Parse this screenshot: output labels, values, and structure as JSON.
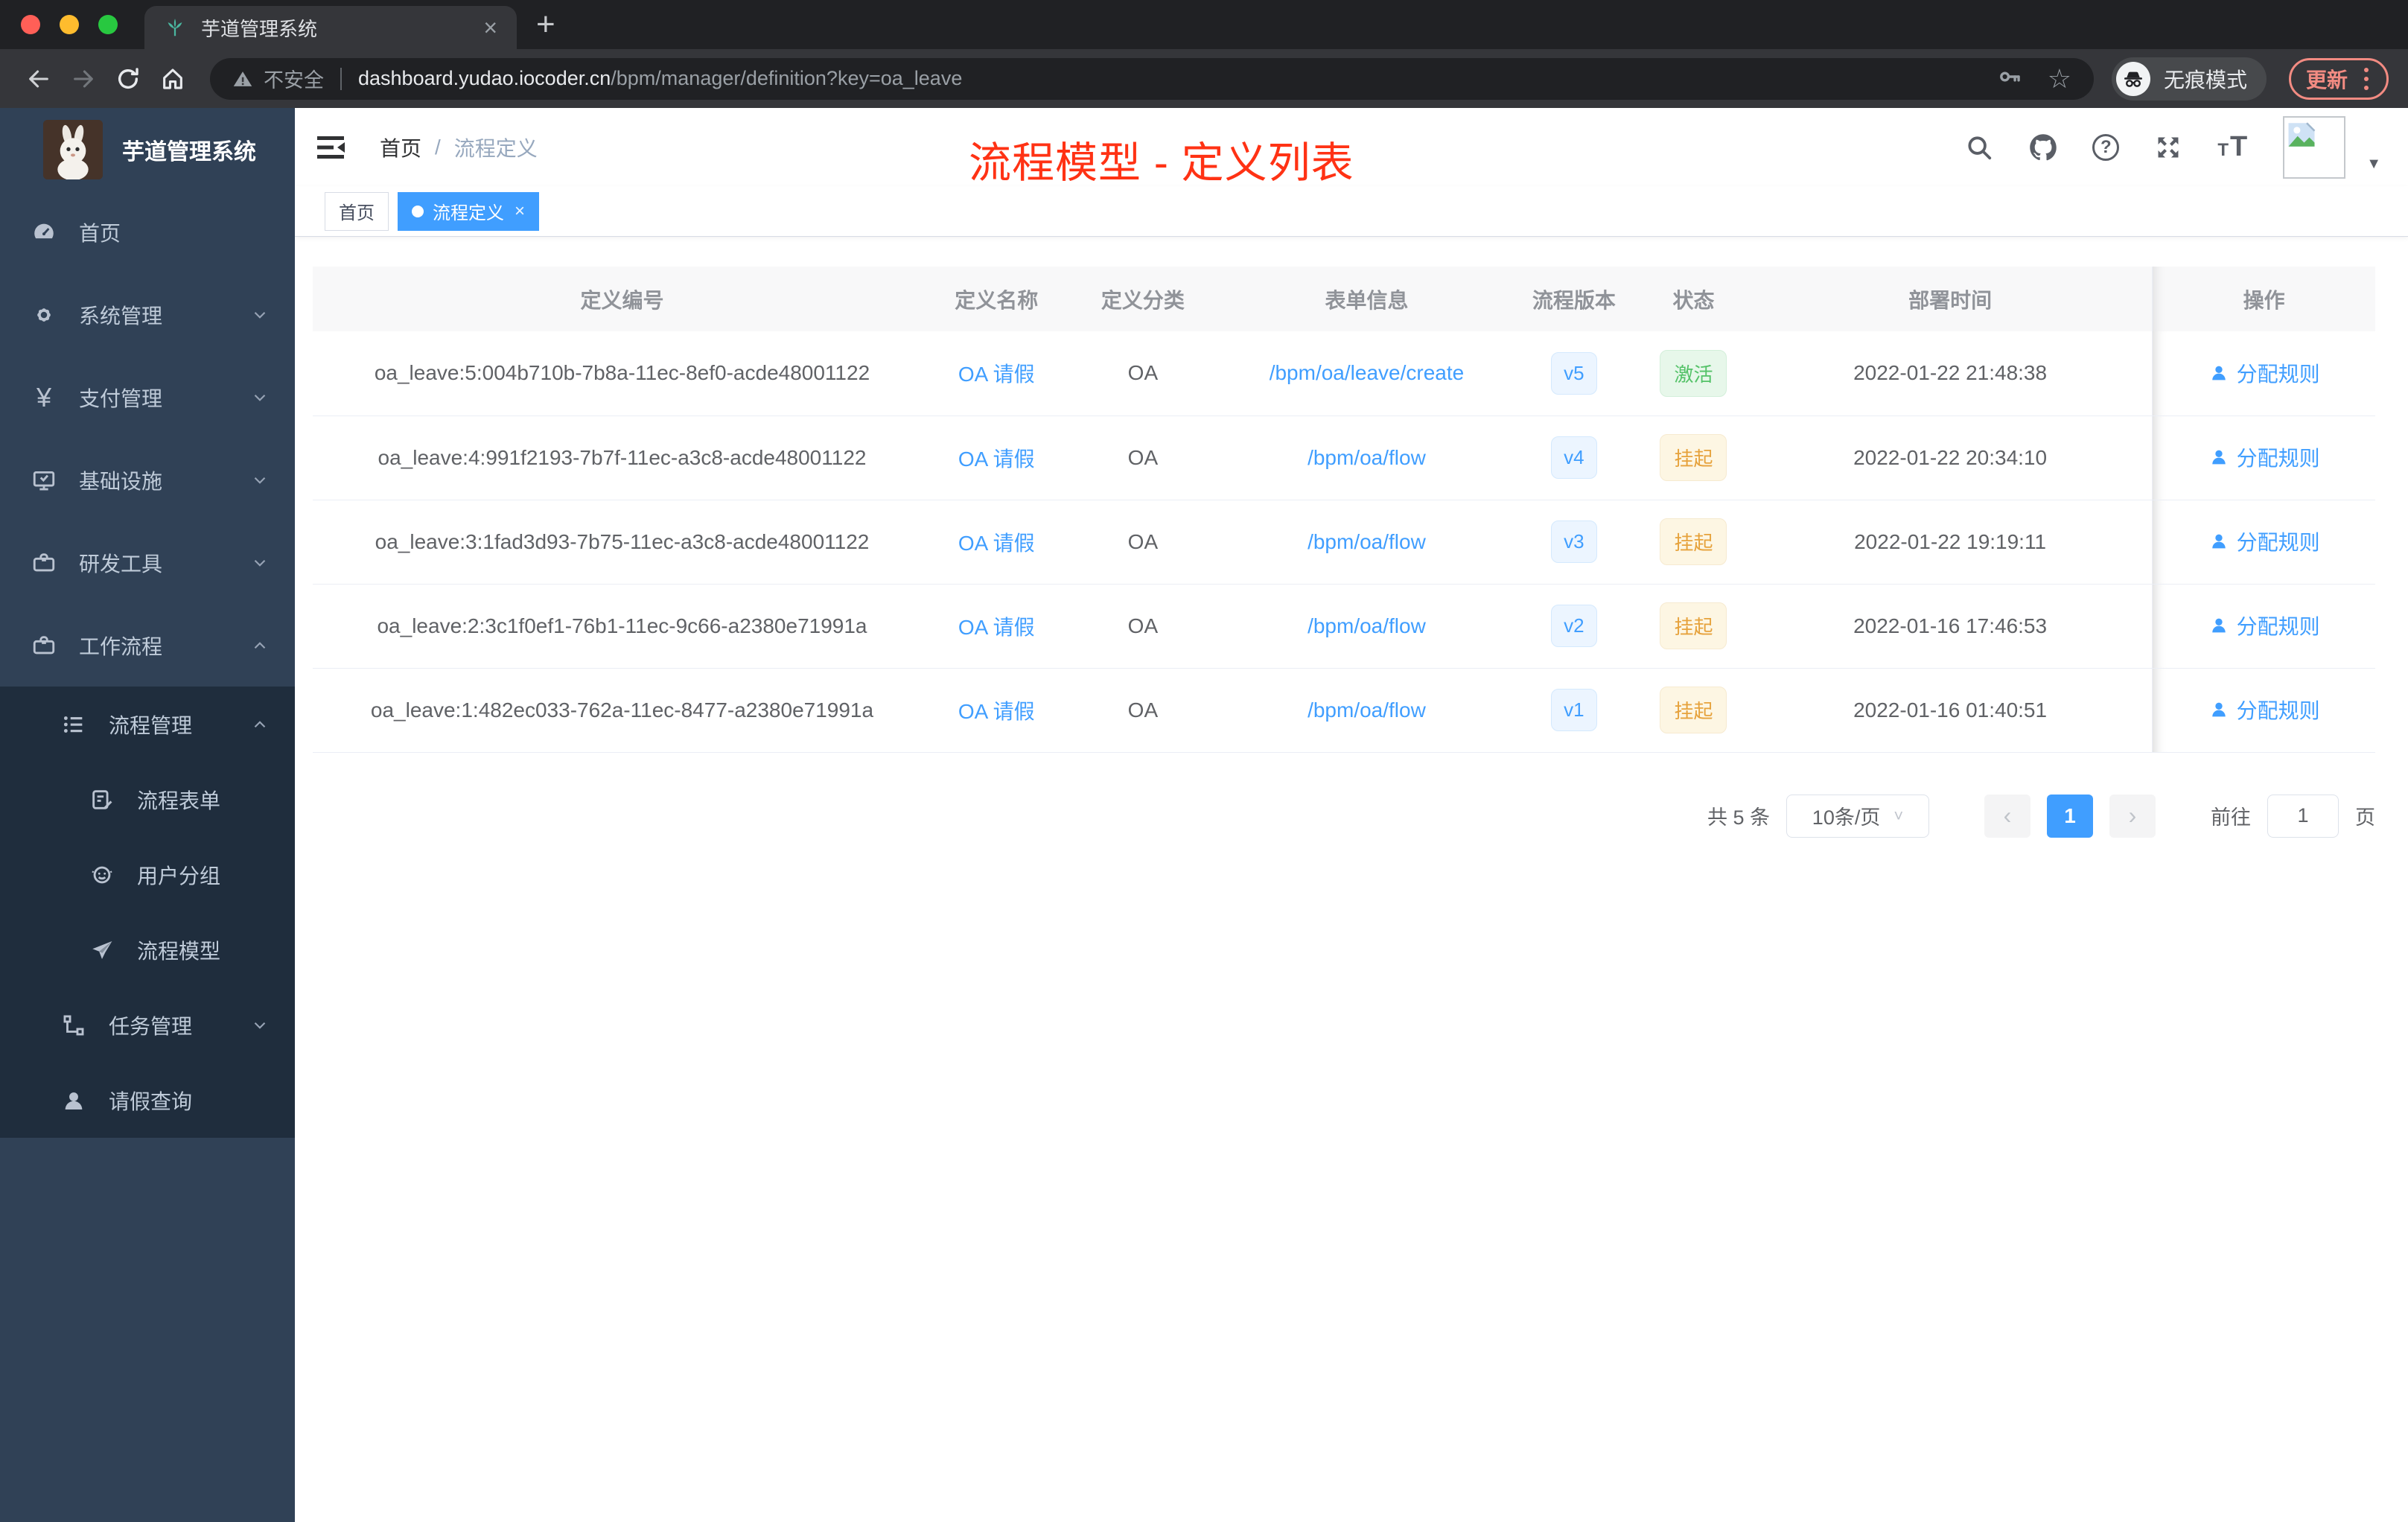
{
  "colors": {
    "accent_blue": "#409eff",
    "annotation_red": "#ff3214",
    "success_green": "#54c268",
    "warning_orange": "#e6a23c",
    "sidebar_bg": "#304156",
    "submenu_bg": "#1f2d3d",
    "update_chip": "#f28b82"
  },
  "browser": {
    "tab_title": "芋道管理系统",
    "security_label": "不安全",
    "url_host": "dashboard.yudao.iocoder.cn",
    "url_path": "/bpm/manager/definition?key=oa_leave",
    "incognito_label": "无痕模式",
    "update_label": "更新"
  },
  "sidebar": {
    "logo_title": "芋道管理系统",
    "menu": [
      {
        "label": "首页"
      },
      {
        "label": "系统管理"
      },
      {
        "label": "支付管理"
      },
      {
        "label": "基础设施"
      },
      {
        "label": "研发工具"
      },
      {
        "label": "工作流程"
      },
      {
        "label": "流程管理"
      },
      {
        "label": "流程表单"
      },
      {
        "label": "用户分组"
      },
      {
        "label": "流程模型"
      },
      {
        "label": "任务管理"
      },
      {
        "label": "请假查询"
      }
    ]
  },
  "navbar": {
    "breadcrumb": [
      "首页",
      "流程定义"
    ],
    "separator": "/"
  },
  "annotation": {
    "text": "流程模型 - 定义列表",
    "color": "#ff3214"
  },
  "tags": {
    "home": "首页",
    "active": "流程定义"
  },
  "table": {
    "columns": [
      "定义编号",
      "定义名称",
      "定义分类",
      "表单信息",
      "流程版本",
      "状态",
      "部署时间",
      "操作"
    ],
    "rows": [
      {
        "id": "oa_leave:5:004b710b-7b8a-11ec-8ef0-acde48001122",
        "name": "OA 请假",
        "category": "OA",
        "form": "/bpm/oa/leave/create",
        "version": "v5",
        "status": "激活",
        "time": "2022-01-22 21:48:38",
        "action": "分配规则"
      },
      {
        "id": "oa_leave:4:991f2193-7b7f-11ec-a3c8-acde48001122",
        "name": "OA 请假",
        "category": "OA",
        "form": "/bpm/oa/flow",
        "version": "v4",
        "status": "挂起",
        "time": "2022-01-22 20:34:10",
        "action": "分配规则"
      },
      {
        "id": "oa_leave:3:1fad3d93-7b75-11ec-a3c8-acde48001122",
        "name": "OA 请假",
        "category": "OA",
        "form": "/bpm/oa/flow",
        "version": "v3",
        "status": "挂起",
        "time": "2022-01-22 19:19:11",
        "action": "分配规则"
      },
      {
        "id": "oa_leave:2:3c1f0ef1-76b1-11ec-9c66-a2380e71991a",
        "name": "OA 请假",
        "category": "OA",
        "form": "/bpm/oa/flow",
        "version": "v2",
        "status": "挂起",
        "time": "2022-01-16 17:46:53",
        "action": "分配规则"
      },
      {
        "id": "oa_leave:1:482ec033-762a-11ec-8477-a2380e71991a",
        "name": "OA 请假",
        "category": "OA",
        "form": "/bpm/oa/flow",
        "version": "v1",
        "status": "挂起",
        "time": "2022-01-16 01:40:51",
        "action": "分配规则"
      }
    ]
  },
  "pagination": {
    "total": "共 5 条",
    "page_size": "10条/页",
    "page": "1",
    "goto_label": "前往",
    "goto_value": "1",
    "unit_label": "页"
  }
}
